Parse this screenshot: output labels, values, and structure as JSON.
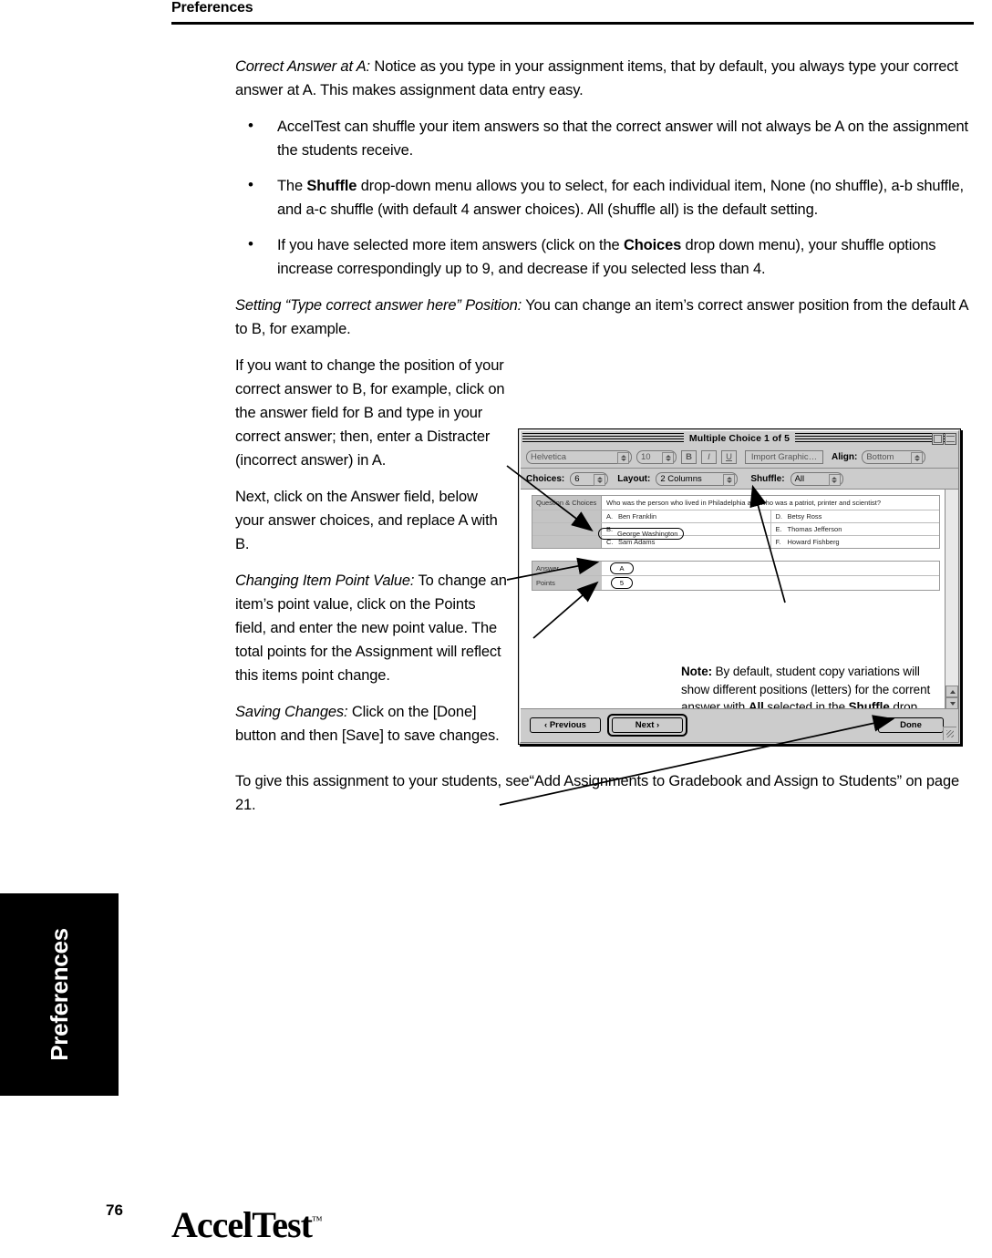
{
  "header": {
    "title": "Preferences"
  },
  "body": {
    "p_correct_answer": {
      "lead": "Correct Answer at A:",
      "rest": " Notice as you type in your assignment items, that by default, you always type your correct answer at A. This makes assignment data entry easy."
    },
    "bullets": [
      {
        "pre": "AccelTest can shuffle your item answers so that the correct answer will not always be A on the assignment the students receive.",
        "bold": "",
        "post": ""
      },
      {
        "pre": "The ",
        "bold": "Shuffle",
        "post": " drop-down menu allows you to select, for each individual item, None (no shuffle), a-b shuffle, and a-c shuffle (with default 4 answer choices). All (shuffle all) is the default setting."
      },
      {
        "pre": "If you have selected more item answers (click on the ",
        "bold": "Choices",
        "post": " drop down menu), your shuffle options increase correspondingly up to 9, and decrease if you selected less than 4."
      }
    ],
    "p_setting_position": {
      "lead": "Setting “Type correct answer here” Position:",
      "rest": " You can change an item’s correct answer position from the default A to B, for example."
    },
    "p_change_position": "If you want to change the position of your correct answer to B, for example, click on the answer field for B and type in your correct answer; then, enter a Distracter (incorrect answer) in A.",
    "p_next_answer_field": "Next, click on the Answer field, below your answer choices, and replace A with B.",
    "p_point_value": {
      "lead": "Changing Item Point Value:",
      "rest": " To change an item’s point value, click on the Points field, and enter the new point value. The total points for the Assignment will reflect this items point change."
    },
    "p_saving_changes": {
      "lead": "Saving Changes:",
      "rest": " Click on the [Done] button and then [Save] to save changes."
    },
    "p_give_assignment": "To give this assignment to your students, see“Add Assignments to Gradebook and Assign to Students” on page 21."
  },
  "figure": {
    "window": {
      "title": "Multiple Choice  1 of 5",
      "toolbar": {
        "font": "Helvetica",
        "size": "10",
        "bold": "B",
        "italic": "I",
        "underline": "U",
        "import_graphic": "Import Graphic…",
        "align_label": "Align:",
        "align_value": "Bottom"
      },
      "toolbar2": {
        "choices_label": "Choices:",
        "choices_value": "6",
        "layout_label": "Layout:",
        "layout_value": "2 Columns",
        "shuffle_label": "Shuffle:",
        "shuffle_value": "All"
      },
      "question_section_label": "Question & Choices",
      "question_text": "Who was the person who lived in Philadelphia and who was a patriot, printer and scientist?",
      "choices": [
        {
          "letter": "A.",
          "text": "Ben Franklin",
          "highlighted": false
        },
        {
          "letter": "D.",
          "text": "Betsy Ross",
          "highlighted": false
        },
        {
          "letter": "B.",
          "text": "George Washington",
          "highlighted": true
        },
        {
          "letter": "E.",
          "text": "Thomas Jefferson",
          "highlighted": false
        },
        {
          "letter": "C.",
          "text": "Sam Adams",
          "highlighted": false
        },
        {
          "letter": "F.",
          "text": "Howard Fishberg",
          "highlighted": false
        }
      ],
      "answer_label": "Answer",
      "answer_value": "A",
      "points_label": "Points",
      "points_value": "5",
      "buttons": {
        "previous": "‹ Previous",
        "next": "Next ›",
        "done": "Done"
      }
    },
    "note": {
      "lead": "Note:",
      "t1": " By default, student copy variations will show different positions (letters) for the corrent answer with ",
      "b1": "All",
      "t2": " selected in the ",
      "b2": "Shuffle",
      "t3": " drop down menu."
    }
  },
  "side_tab": {
    "label": "Preferences"
  },
  "footer": {
    "page_number": "76",
    "logo": "AccelTest",
    "logo_tm": "™"
  }
}
